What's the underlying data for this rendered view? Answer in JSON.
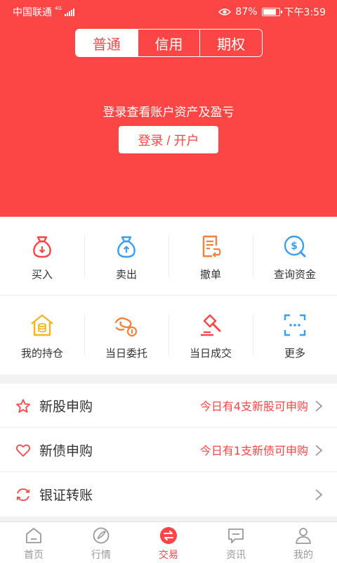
{
  "status_bar": {
    "carrier": "中国联通",
    "network": "4G",
    "battery": "87%",
    "battery_level": 0.87,
    "time": "下午3:59"
  },
  "account_tabs": {
    "items": [
      {
        "label": "普通",
        "active": true
      },
      {
        "label": "信用",
        "active": false
      },
      {
        "label": "期权",
        "active": false
      }
    ]
  },
  "hero": {
    "prompt": "登录查看账户资产及盈亏",
    "login_label": "登录 / 开户"
  },
  "quick_actions": {
    "row1": [
      {
        "label": "买入",
        "icon": "buy-bag-icon"
      },
      {
        "label": "卖出",
        "icon": "sell-bag-icon"
      },
      {
        "label": "撤单",
        "icon": "cancel-order-icon"
      },
      {
        "label": "查询资金",
        "icon": "query-funds-icon"
      }
    ],
    "row2": [
      {
        "label": "我的持仓",
        "icon": "holdings-icon"
      },
      {
        "label": "当日委托",
        "icon": "daily-orders-icon"
      },
      {
        "label": "当日成交",
        "icon": "daily-deals-icon"
      },
      {
        "label": "更多",
        "icon": "more-icon"
      }
    ]
  },
  "list": [
    {
      "title": "新股申购",
      "hint": "今日有4支新股可申购",
      "icon": "star-icon"
    },
    {
      "title": "新债申购",
      "hint": "今日有1支新债可申购",
      "icon": "heart-icon"
    },
    {
      "title": "银证转账",
      "hint": "",
      "icon": "transfer-icon"
    }
  ],
  "tab_bar": [
    {
      "label": "首页",
      "icon": "home-icon",
      "active": false
    },
    {
      "label": "行情",
      "icon": "market-icon",
      "active": false
    },
    {
      "label": "交易",
      "icon": "trade-icon",
      "active": true
    },
    {
      "label": "资讯",
      "icon": "news-icon",
      "active": false
    },
    {
      "label": "我的",
      "icon": "profile-icon",
      "active": false
    }
  ],
  "colors": {
    "brand": "#fc4545",
    "orange": "#f5813a",
    "blue": "#3a9ef5",
    "yellow": "#f5b51c"
  }
}
